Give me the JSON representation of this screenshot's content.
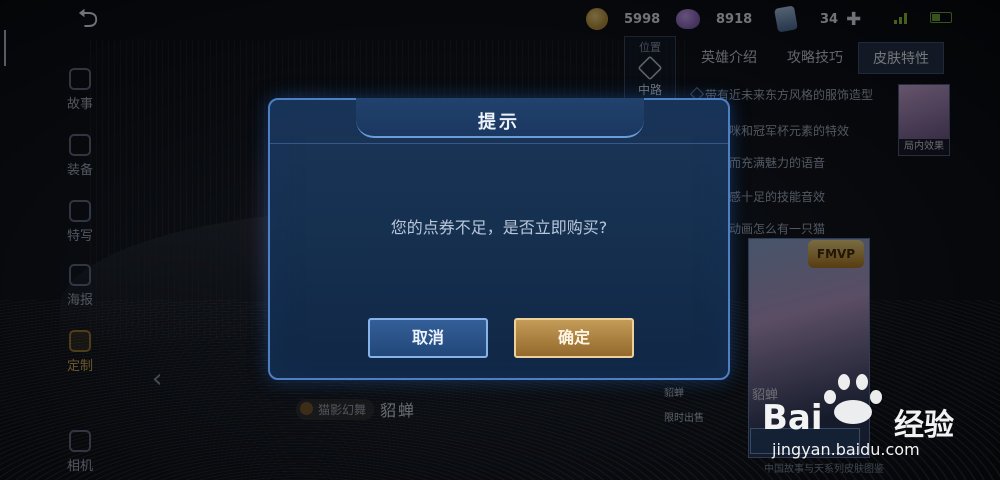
{
  "topbar": {
    "back_icon": "back-arrow-icon",
    "gold": "5998",
    "diamonds": "8918",
    "cards": "34"
  },
  "sidebar": {
    "items": [
      {
        "label": "故事",
        "icon": "book-icon",
        "active": false
      },
      {
        "label": "装备",
        "icon": "armor-icon",
        "active": false
      },
      {
        "label": "特写",
        "icon": "closeup-icon",
        "active": false
      },
      {
        "label": "海报",
        "icon": "poster-icon",
        "active": false
      },
      {
        "label": "定制",
        "icon": "custom-icon",
        "active": true
      },
      {
        "label": "相机",
        "icon": "camera-ar-icon",
        "active": false
      }
    ]
  },
  "lane": {
    "title": "位置",
    "name": "中路"
  },
  "tabs": [
    "英雄介绍",
    "攻略技巧",
    "皮肤特性"
  ],
  "features": [
    "带有近未来东方风格的服饰造型",
    "有猫咪和冠军杯元素的特效",
    "甜美而充满魅力的语音",
    "节奏感十足的技能音效",
    "回城动画怎么有一只猫"
  ],
  "effect_label": "局内效果",
  "skin_badge": "FMVP",
  "skin_strip": [
    "貂蝉",
    "限时出售"
  ],
  "skin_name_right": "貂蝉",
  "skin_foot": "中国故事与天系列皮肤图鉴",
  "skin_tag": "猫影幻舞",
  "hero_name": "貂蝉",
  "dialog": {
    "title": "提示",
    "message": "您的点券不足，是否立即购买?",
    "cancel": "取消",
    "confirm": "确定"
  },
  "watermark": {
    "brand": "Bai",
    "suffix": "经验",
    "url": "jingyan.baidu.com"
  }
}
